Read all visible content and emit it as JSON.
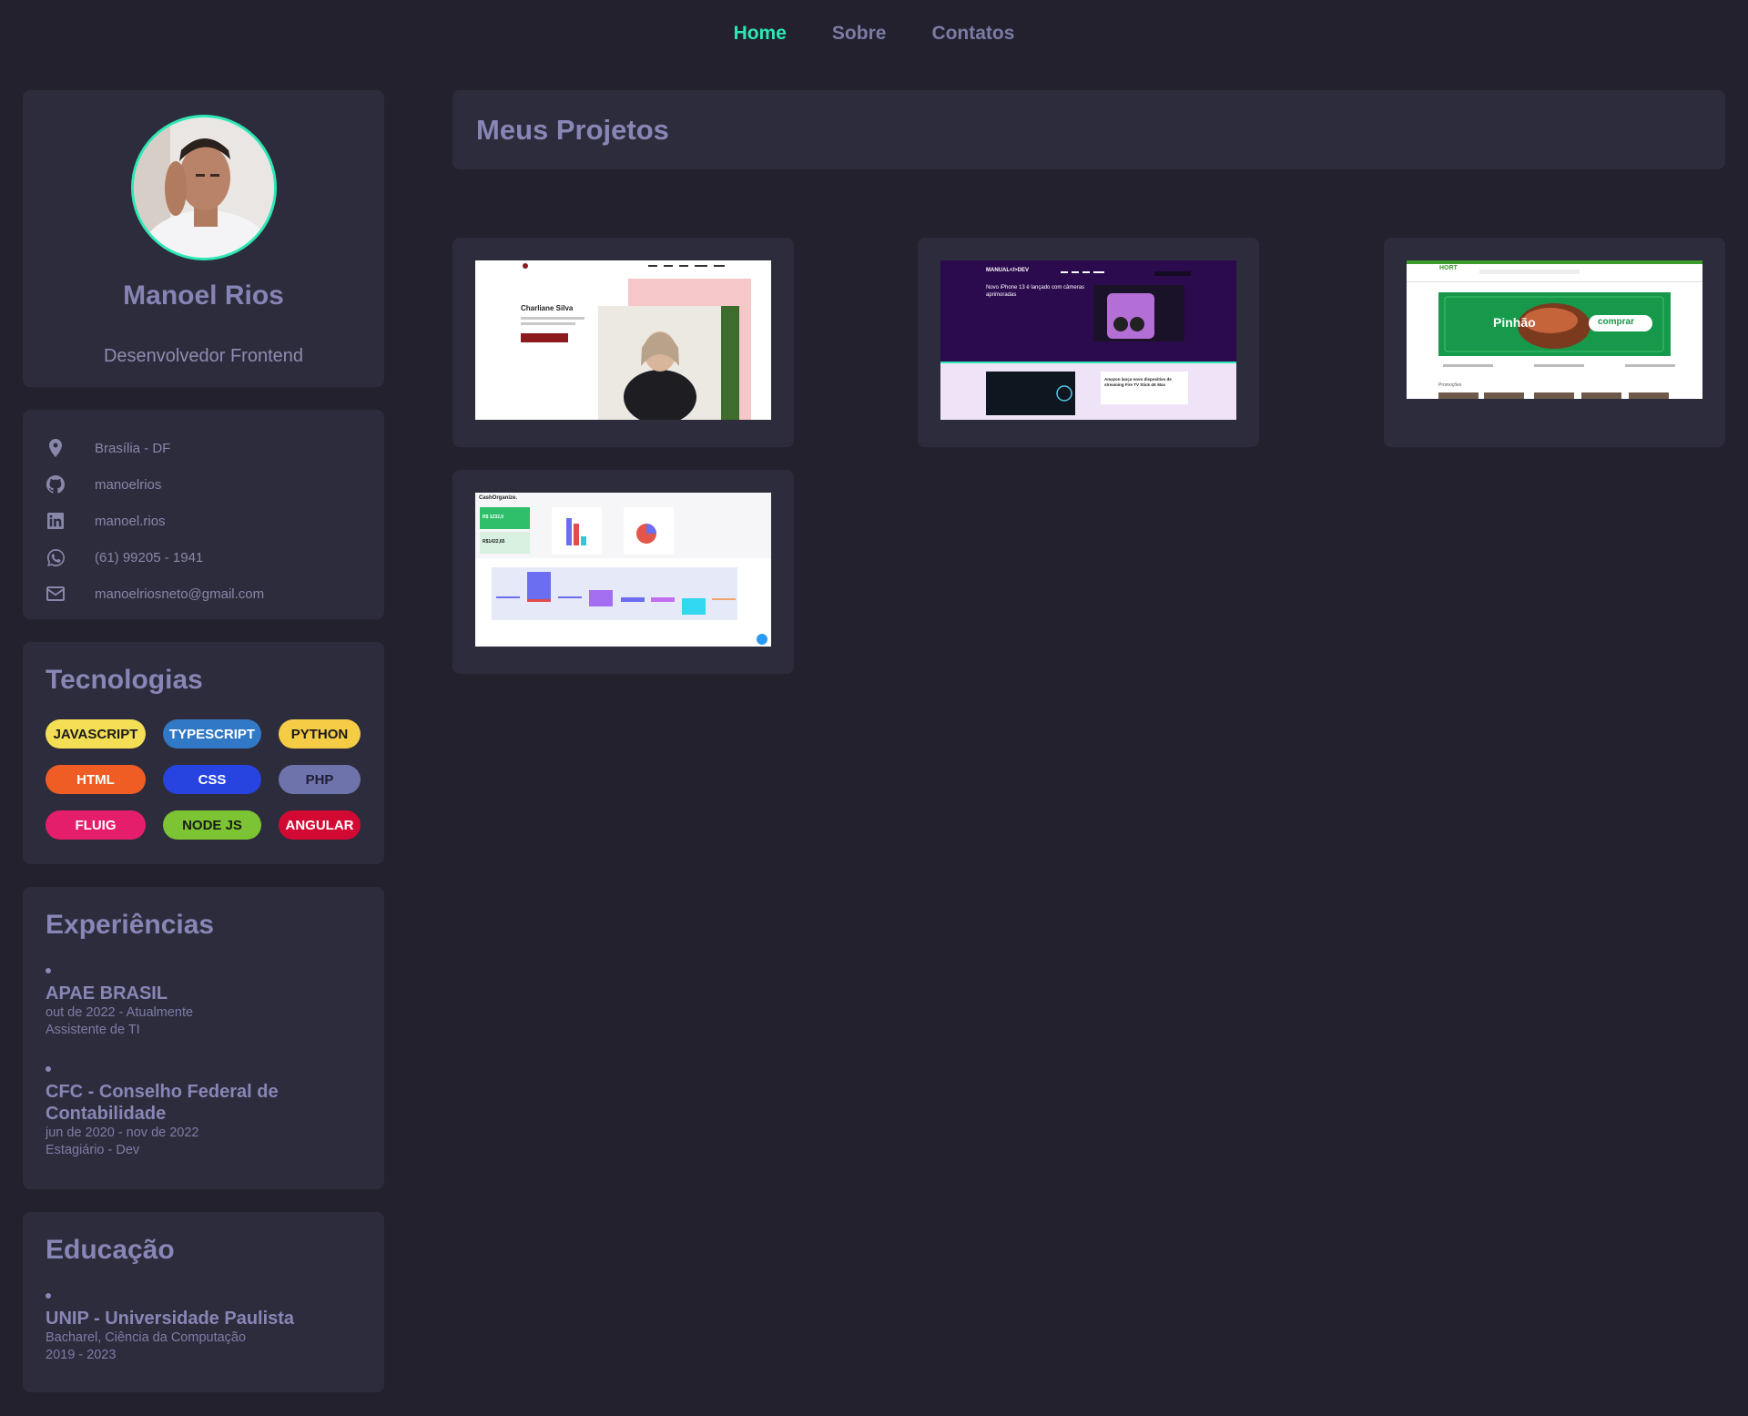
{
  "nav": {
    "home": "Home",
    "about": "Sobre",
    "contacts": "Contatos"
  },
  "profile": {
    "name": "Manoel Rios",
    "role": "Desenvolvedor Frontend"
  },
  "contacts": {
    "location": "Brasília - DF",
    "github": "manoelrios",
    "linkedin": "manoel.rios",
    "phone": "(61) 99205 - 1941",
    "email": "manoelriosneto@gmail.com"
  },
  "tech": {
    "title": "Tecnologias",
    "tags": [
      "JAVASCRIPT",
      "TYPESCRIPT",
      "PYTHON",
      "HTML",
      "CSS",
      "PHP",
      "FLUIG",
      "NODE JS",
      "ANGULAR"
    ],
    "colors": [
      "#f3de56",
      "#3178c6",
      "#f5cc46",
      "#ef5d24",
      "#2743e0",
      "#6f73ab",
      "#e41e6a",
      "#7cc434",
      "#d20a33"
    ]
  },
  "experience": {
    "title": "Experiências",
    "items": [
      {
        "company": "APAE BRASIL",
        "period": "out de 2022 - Atualmente",
        "role": "Assistente de TI"
      },
      {
        "company": "CFC - Conselho Federal de Contabilidade",
        "period": "jun de 2020 - nov de 2022",
        "role": "Estagiário - Dev"
      }
    ]
  },
  "education": {
    "title": "Educação",
    "items": [
      {
        "school": "UNIP - Universidade Paulista",
        "course": "Bacharel, Ciência da Computação",
        "period": "2019 - 2023"
      }
    ]
  },
  "projects": {
    "title": "Meus Projetos",
    "p1": {
      "name": "Charliane Silva"
    },
    "p2": {
      "brand": "MANUAL</>DEV",
      "headline": "Novo iPhone 13 é lançado com câmeras aprimoradas",
      "news": "Amazon lança novo dispositivo de streaming Fire TV Stick 4K Max"
    },
    "p3": {
      "brand": "HORT",
      "promo": "Pinhão",
      "cta": "comprar",
      "section": "Promoções"
    },
    "p4": {
      "brand": "CashOrganize.",
      "balance1": "R$ 1232,0",
      "balance2": "R$1422,65"
    }
  }
}
